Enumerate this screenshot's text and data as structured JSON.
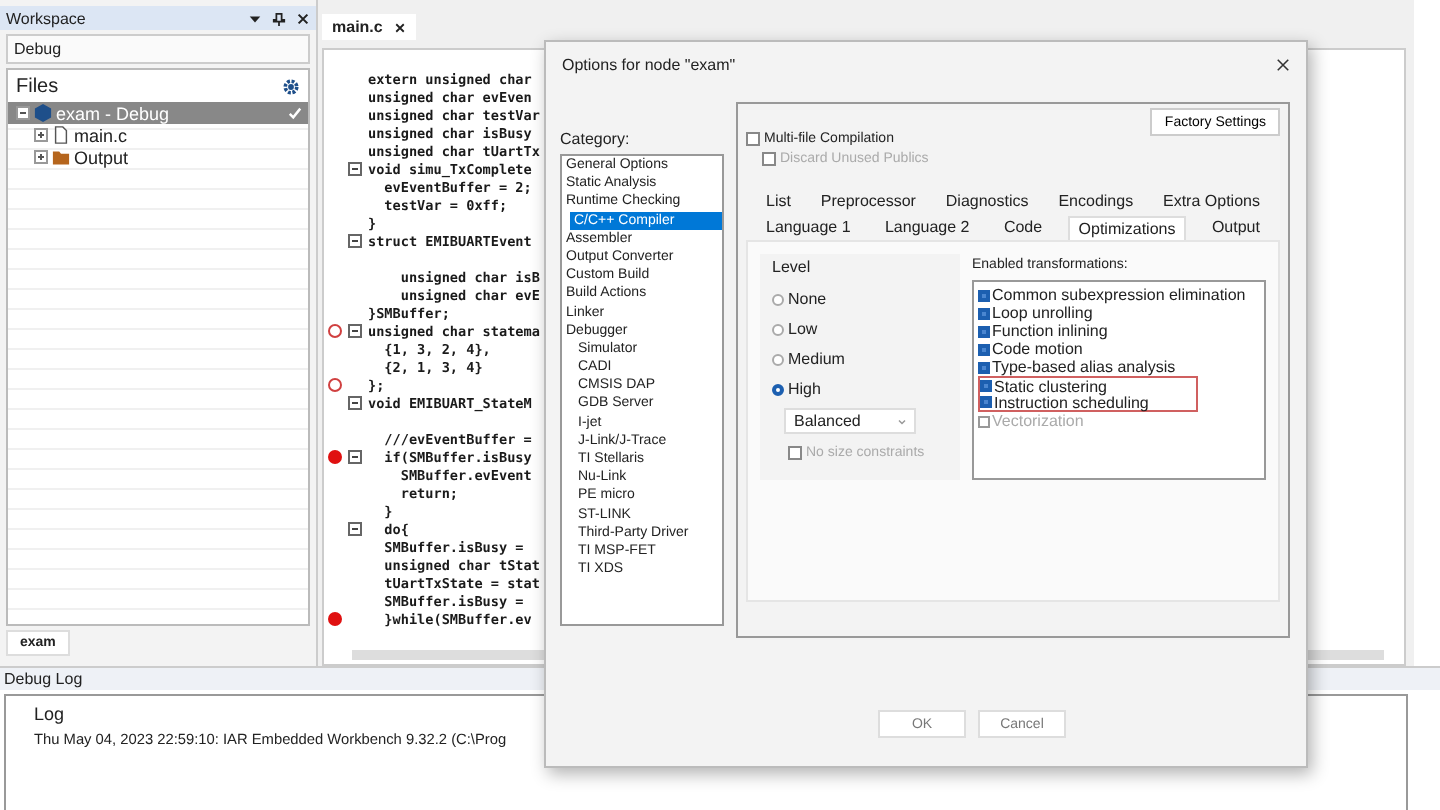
{
  "workspace": {
    "title": "Workspace",
    "configuration": "Debug",
    "files_header": "Files",
    "tree": [
      {
        "label": "exam - Debug",
        "selected": true,
        "kind": "project",
        "children": [
          {
            "label": "main.c",
            "selected": false,
            "kind": "file"
          },
          {
            "label": "Output",
            "selected": false,
            "kind": "folder"
          }
        ]
      }
    ],
    "bottom_tab": "exam"
  },
  "editor": {
    "tab": "main.c",
    "lines": [
      {
        "text": "extern unsigned char",
        "breakpoint": false,
        "fold": false
      },
      {
        "text": "unsigned char evEven",
        "breakpoint": false,
        "fold": false
      },
      {
        "text": "unsigned char testVar",
        "breakpoint": false,
        "fold": false
      },
      {
        "text": "unsigned char isBusy",
        "breakpoint": false,
        "fold": false
      },
      {
        "text": "unsigned char tUartTx",
        "breakpoint": false,
        "fold": false
      },
      {
        "text": "void simu_TxComplete",
        "breakpoint": false,
        "fold": true
      },
      {
        "text": "  evEventBuffer = 2;",
        "breakpoint": false,
        "fold": false
      },
      {
        "text": "  testVar = 0xff;",
        "breakpoint": false,
        "fold": false
      },
      {
        "text": "}",
        "breakpoint": false,
        "fold": false
      },
      {
        "text": "struct EMIBUARTEvent",
        "breakpoint": false,
        "fold": true
      },
      {
        "breakpoint": false,
        "fold": false
      },
      {
        "text": "    unsigned char isB",
        "breakpoint": false,
        "fold": false
      },
      {
        "text": "    unsigned char evE",
        "breakpoint": false,
        "fold": false
      },
      {
        "text": "}SMBuffer;",
        "breakpoint": false,
        "fold": false
      },
      {
        "text": "unsigned char statema",
        "breakpoint": true,
        "breakpoint_disabled": true,
        "fold": true
      },
      {
        "text": "  {1, 3, 2, 4},",
        "breakpoint": false,
        "fold": false
      },
      {
        "text": "  {2, 1, 3, 4}",
        "breakpoint": false,
        "fold": false
      },
      {
        "text": "};",
        "breakpoint": true,
        "breakpoint_disabled": true,
        "fold": false
      },
      {
        "text": "void EMIBUART_StateM",
        "breakpoint": false,
        "fold": true
      },
      {
        "breakpoint": false,
        "fold": false
      },
      {
        "text": "  ///evEventBuffer =",
        "breakpoint": false,
        "fold": false
      },
      {
        "text": "  if(SMBuffer.isBusy",
        "breakpoint": true,
        "breakpoint_disabled": false,
        "fold": true
      },
      {
        "text": "    SMBuffer.evEvent",
        "breakpoint": false,
        "fold": false
      },
      {
        "text": "    return;",
        "breakpoint": false,
        "fold": false
      },
      {
        "text": "  }",
        "breakpoint": false,
        "fold": false
      },
      {
        "text": "  do{",
        "breakpoint": false,
        "fold": true
      },
      {
        "text": "  SMBuffer.isBusy =",
        "breakpoint": false,
        "fold": false
      },
      {
        "text": "  unsigned char tStat",
        "breakpoint": false,
        "fold": false
      },
      {
        "text": "  tUartTxState = stat",
        "breakpoint": false,
        "fold": false
      },
      {
        "text": "  SMBuffer.isBusy =",
        "breakpoint": false,
        "fold": false
      },
      {
        "text": "  }while(SMBuffer.ev",
        "breakpoint": true,
        "breakpoint_disabled": false,
        "fold": false
      }
    ]
  },
  "debug_log": {
    "title": "Debug Log",
    "header": "Log",
    "entries": [
      "Thu May 04, 2023 22:59:10: IAR Embedded Workbench 9.32.2 (C:\\Prog"
    ]
  },
  "dialog": {
    "title": "Options for node \"exam\"",
    "category_label": "Category:",
    "categories": [
      {
        "label": "General Options",
        "selected": false
      },
      {
        "label": "Static Analysis",
        "selected": false
      },
      {
        "label": "Runtime Checking",
        "selected": false
      },
      {
        "label": "C/C++ Compiler",
        "selected": true
      },
      {
        "label": "Assembler",
        "selected": false
      },
      {
        "label": "Output Converter",
        "selected": false
      },
      {
        "label": "Custom Build",
        "selected": false
      },
      {
        "label": "Build Actions",
        "selected": false
      },
      {
        "label": "Linker",
        "selected": false
      },
      {
        "label": "Debugger",
        "selected": false,
        "children": [
          {
            "label": "Simulator",
            "selected": false
          },
          {
            "label": "CADI",
            "selected": false
          },
          {
            "label": "CMSIS DAP",
            "selected": false
          },
          {
            "label": "GDB Server",
            "selected": false
          },
          {
            "label": "I-jet",
            "selected": false
          },
          {
            "label": "J-Link/J-Trace",
            "selected": false
          },
          {
            "label": "TI Stellaris",
            "selected": false
          },
          {
            "label": "Nu-Link",
            "selected": false
          },
          {
            "label": "PE micro",
            "selected": false
          },
          {
            "label": "ST-LINK",
            "selected": false
          },
          {
            "label": "Third-Party Driver",
            "selected": false
          },
          {
            "label": "TI MSP-FET",
            "selected": false
          },
          {
            "label": "TI XDS",
            "selected": false
          }
        ]
      }
    ],
    "multi_file": {
      "label": "Multi-file Compilation",
      "checked": false
    },
    "discard_unused": {
      "label": "Discard Unused Publics",
      "checked": false,
      "disabled": true
    },
    "factory_button": "Factory Settings",
    "tab_rows": [
      [
        {
          "label": "List",
          "selected": false
        },
        {
          "label": "Preprocessor",
          "selected": false
        },
        {
          "label": "Diagnostics",
          "selected": false
        },
        {
          "label": "Encodings",
          "selected": false
        },
        {
          "label": "Extra Options",
          "selected": false
        }
      ],
      [
        {
          "label": "Language 1",
          "selected": false
        },
        {
          "label": "Language 2",
          "selected": false
        },
        {
          "label": "Code",
          "selected": false
        },
        {
          "label": "Optimizations",
          "selected": true
        },
        {
          "label": "Output",
          "selected": false
        }
      ]
    ],
    "level": {
      "title": "Level",
      "options": [
        {
          "label": "None",
          "selected": false
        },
        {
          "label": "Low",
          "selected": false
        },
        {
          "label": "Medium",
          "selected": false
        },
        {
          "label": "High",
          "selected": true
        }
      ],
      "strategy": "Balanced",
      "no_size": {
        "label": "No size constraints",
        "checked": false,
        "disabled": true
      }
    },
    "transformations": {
      "title": "Enabled transformations:",
      "items": [
        {
          "label": "Common subexpression elimination",
          "checked": true,
          "disabled": false,
          "highlighted": false
        },
        {
          "label": "Loop unrolling",
          "checked": true,
          "disabled": false,
          "highlighted": false
        },
        {
          "label": "Function inlining",
          "checked": true,
          "disabled": false,
          "highlighted": false
        },
        {
          "label": "Code motion",
          "checked": true,
          "disabled": false,
          "highlighted": false
        },
        {
          "label": "Type-based alias analysis",
          "checked": true,
          "disabled": false,
          "highlighted": false
        },
        {
          "label": "Static clustering",
          "checked": true,
          "disabled": false,
          "highlighted": true
        },
        {
          "label": "Instruction scheduling",
          "checked": true,
          "disabled": false,
          "highlighted": true
        },
        {
          "label": "Vectorization",
          "checked": false,
          "disabled": true,
          "highlighted": false
        }
      ]
    },
    "buttons": [
      "OK",
      "Cancel"
    ]
  }
}
